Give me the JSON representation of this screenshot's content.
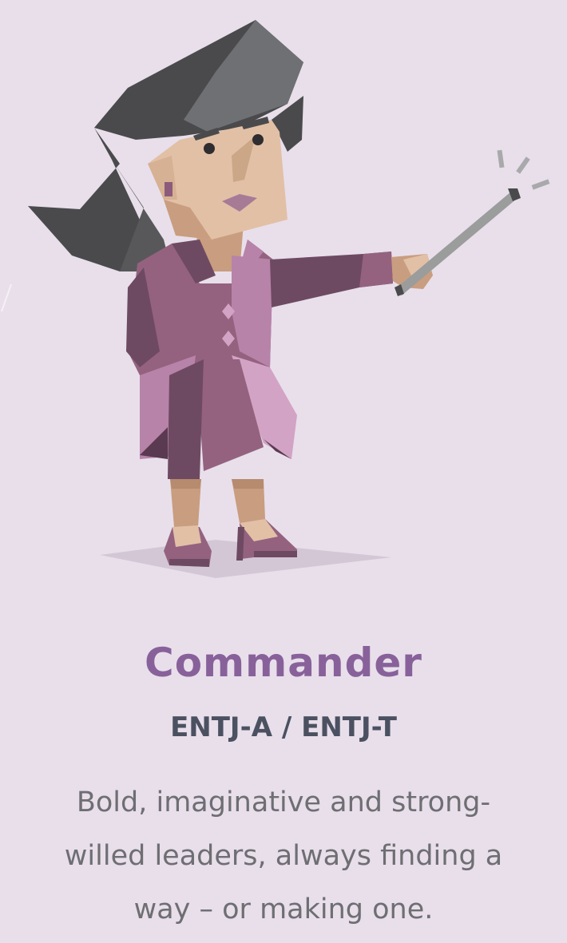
{
  "personality": {
    "name": "Commander",
    "codes": "ENTJ-A / ENTJ-T",
    "description": "Bold, imaginative and strong-willed leaders, always finding a way – or making one."
  },
  "illustration": {
    "subject": "commander-character-pointing-icon",
    "colors": {
      "background": "#e8dfeb",
      "title": "#88619a",
      "code": "#4b5160",
      "description": "#6e6e73",
      "suit_dark": "#6e4a62",
      "suit_mid": "#94627f",
      "suit_light": "#b783a8",
      "suit_pale": "#d2a3c4",
      "hair_dark": "#4a4a4c",
      "hair_light": "#6f7073",
      "skin": "#e2c0a6",
      "skin_shadow": "#c99d7f",
      "pointer": "#9b9c9c"
    }
  }
}
